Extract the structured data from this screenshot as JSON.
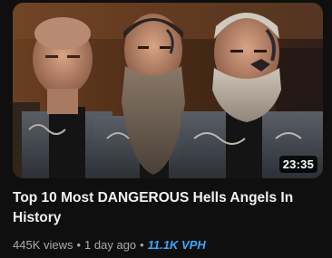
{
  "video": {
    "thumbnail": {
      "description_icon": "thumbnail-image",
      "duration": "23:35"
    },
    "title": "Top 10 Most DANGEROUS Hells Angels In History",
    "views": "445K views",
    "age": "1 day ago",
    "separator": "•",
    "vph": "11.1K VPH",
    "colors": {
      "background": "#0f0f0f",
      "title": "#f1f1f1",
      "meta": "#aaaaaa",
      "vph_accent": "#3ea6ff"
    }
  }
}
